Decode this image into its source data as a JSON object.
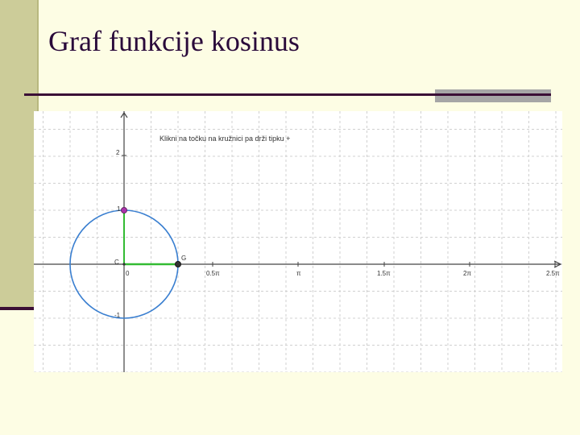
{
  "slide": {
    "title": "Graf funkcije kosinus"
  },
  "applet": {
    "instruction": "Klikni na točku na kružnici pa drži tipku +",
    "origin_label": "C",
    "point_label": "G",
    "y_tick_labels": [
      "2",
      "1",
      "-1"
    ],
    "x_tick_labels": [
      "0",
      "0.5π",
      "π",
      "1.5π",
      "2π",
      "2.5π"
    ],
    "circle_color": "#3a7fd0",
    "segment_color": "#33bb33",
    "top_point_color": "#aa33aa",
    "point_color": "#333333",
    "grid_color": "#d0d0d0",
    "axis_color": "#444444"
  }
}
